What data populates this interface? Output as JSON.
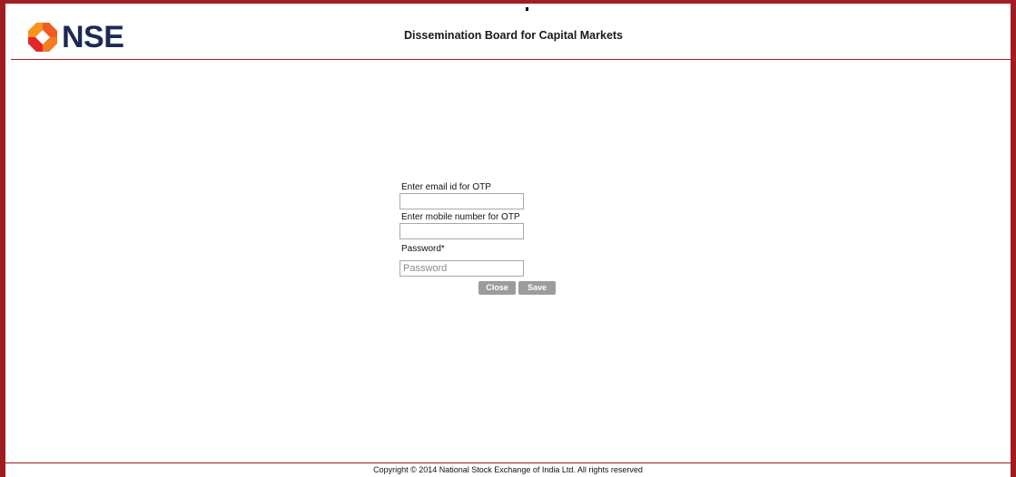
{
  "header": {
    "logo_text": "NSE",
    "title": "Dissemination Board for Capital Markets"
  },
  "form": {
    "email_label": "Enter email id for OTP",
    "email_value": "",
    "mobile_label": "Enter mobile number for OTP",
    "mobile_value": "",
    "password_label": "Password*",
    "password_placeholder": "Password",
    "close_label": "Close",
    "save_label": "Save"
  },
  "footer": {
    "copyright": "Copyright © 2014 National Stock Exchange of India Ltd. All rights reserved"
  },
  "colors": {
    "brand_red": "#a01e22",
    "brand_navy": "#1b2a57",
    "logo_orange": "#f7941d",
    "logo_red": "#e2262a",
    "button_gray": "#9c9c9c"
  },
  "icons": {
    "logo": "nse-logo-icon"
  }
}
